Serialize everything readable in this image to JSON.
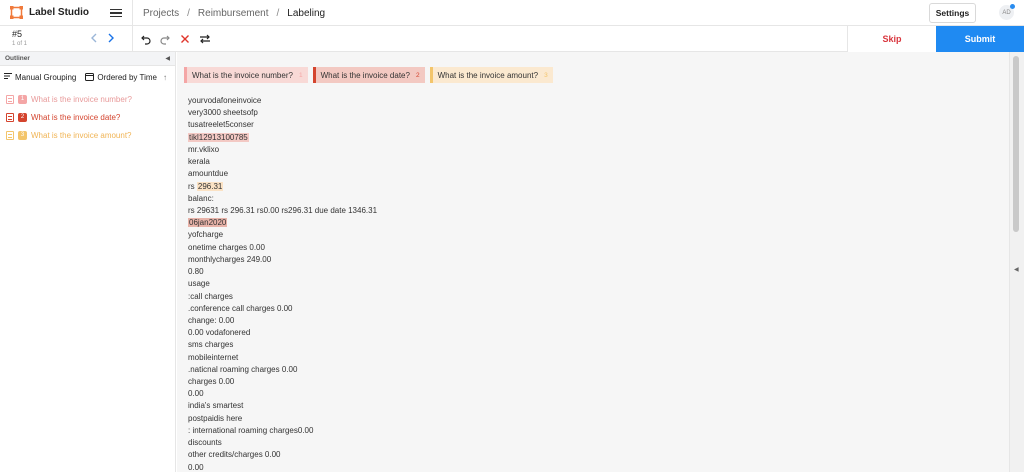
{
  "app": {
    "name": "Label Studio"
  },
  "breadcrumb": [
    {
      "label": "Projects"
    },
    {
      "label": "Reimbursement"
    },
    {
      "label": "Labeling"
    }
  ],
  "header": {
    "settings_label": "Settings",
    "avatar_initials": "AD"
  },
  "task": {
    "id": "#5",
    "count": "1 of 1"
  },
  "actions": {
    "skip_label": "Skip",
    "submit_label": "Submit"
  },
  "outliner": {
    "title": "Outliner",
    "grouping_label": "Manual Grouping",
    "ordering_label": "Ordered by Time",
    "regions": [
      {
        "index": "1",
        "label": "What is the invoice number?",
        "color": "#f4a6a6",
        "text_color": "#e89a9a"
      },
      {
        "index": "2",
        "label": "What is the invoice date?",
        "color": "#d4442e",
        "text_color": "#d4442e"
      },
      {
        "index": "3",
        "label": "What is the invoice amount?",
        "color": "#f3c56b",
        "text_color": "#f0b455"
      }
    ]
  },
  "labels": [
    {
      "text": "What is the invoice number?",
      "hotkey": "1",
      "border": "#f4a6a6",
      "bg": "#f8d9d6"
    },
    {
      "text": "What is the invoice date?",
      "hotkey": "2",
      "border": "#d4442e",
      "bg": "#f3c9c2"
    },
    {
      "text": "What is the invoice amount?",
      "hotkey": "3",
      "border": "#f3c56b",
      "bg": "#fbe9d0"
    }
  ],
  "document": {
    "lines": [
      {
        "text": "yourvodafoneinvoice"
      },
      {
        "text": "very3000 sheetsofp"
      },
      {
        "text": "tusatreelet5conser"
      },
      {
        "text": "",
        "hl": "tikl12913100785",
        "hl_color": "#f3c9c4"
      },
      {
        "text": "mr.vklixo"
      },
      {
        "text": "kerala"
      },
      {
        "text": "amountdue"
      },
      {
        "text": "rs ",
        "hl": "296.31",
        "hl_color": "#fbe2c4"
      },
      {
        "text": "balanc:"
      },
      {
        "text": "rs 29631 rs 296.31 rs0.00 rs296.31 due date 1346.31"
      },
      {
        "text": "",
        "hl": "06jan2020",
        "hl_color": "#e8b3a9"
      },
      {
        "text": "yofcharge"
      },
      {
        "text": "onetime charges 0.00"
      },
      {
        "text": "monthlycharges 249.00"
      },
      {
        "text": "0.80"
      },
      {
        "text": "usage"
      },
      {
        "text": ":call charges"
      },
      {
        "text": ".conference call charges 0.00"
      },
      {
        "text": "change: 0.00"
      },
      {
        "text": "0.00 vodafonered"
      },
      {
        "text": "sms charges"
      },
      {
        "text": "mobileinternet"
      },
      {
        "text": ".naticnal roaming charges 0.00"
      },
      {
        "text": "charges 0.00"
      },
      {
        "text": "0.00"
      },
      {
        "text": "india's smartest"
      },
      {
        "text": "postpaidis here"
      },
      {
        "text": ": international roaming charges0.00"
      },
      {
        "text": "discounts"
      },
      {
        "text": "other credits/charges 0.00"
      },
      {
        "text": "0.00"
      }
    ]
  },
  "icons": {
    "undo": "undo-icon",
    "redo": "redo-icon",
    "reset": "close-icon",
    "swap": "swap-icon"
  }
}
